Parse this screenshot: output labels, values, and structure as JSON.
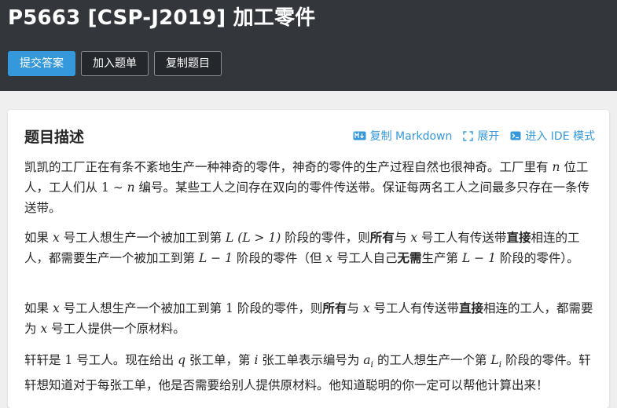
{
  "header": {
    "title": "P5663 [CSP-J2019] 加工零件",
    "buttons": {
      "submit": "提交答案",
      "add_to_list": "加入题单",
      "copy_problem": "复制题目"
    }
  },
  "section": {
    "title": "题目描述",
    "actions": {
      "copy_markdown": "复制 Markdown",
      "expand": "展开",
      "enter_ide": "进入 IDE 模式"
    }
  },
  "description": {
    "p1": {
      "a": "凯凯的工厂正在有条不紊地生产一种神奇的零件，神奇的零件的生产过程自然也很神奇。工厂里有 ",
      "m1": "n",
      "b": " 位工人，工人们从 ",
      "m2": "1 ∼ ",
      "m3": "n",
      "c": " 编号。某些工人之间存在双向的零件传送带。保证每两名工人之间最多只存在一条传送带。"
    },
    "p2": {
      "a": "如果 ",
      "m1": "x",
      "b": " 号工人想生产一个被加工到第 ",
      "m2": "L (L > 1)",
      "c": " 阶段的零件，则",
      "bold1": "所有",
      "d": "与 ",
      "m3": "x",
      "e": " 号工人有传送带",
      "bold2": "直接",
      "f": "相连的工人，都需要生产一个被加工到第 ",
      "m4": "L − 1",
      "g": " 阶段的零件（但 ",
      "m5": "x",
      "h": " 号工人自己",
      "bold3": "无需",
      "i": "生产第 ",
      "m6": "L − 1",
      "j": " 阶段的零件）。"
    },
    "p3": {
      "a": "如果 ",
      "m1": "x",
      "b": " 号工人想生产一个被加工到第 ",
      "m2": "1",
      "c": " 阶段的零件，则",
      "bold1": "所有",
      "d": "与 ",
      "m3": "x",
      "e": " 号工人有传送带",
      "bold2": "直接",
      "f": "相连的工人，都需要为 ",
      "m4": "x",
      "g": " 号工人提供一个原材料。"
    },
    "p4": {
      "a": "轩轩是 ",
      "m1": "1",
      "b": " 号工人。现在给出 ",
      "m2": "q",
      "c": " 张工单，第 ",
      "m3": "i",
      "d": " 张工单表示编号为 ",
      "m4": "a",
      "m4sub": "i",
      "e": " 的工人想生产一个第 ",
      "m5": "L",
      "m5sub": "i",
      "f": " 阶段的零件。轩轩想知道对于每张工单，他是否需要给别人提供原材料。他知道聪明的你一定可以帮他计算出来！"
    }
  }
}
